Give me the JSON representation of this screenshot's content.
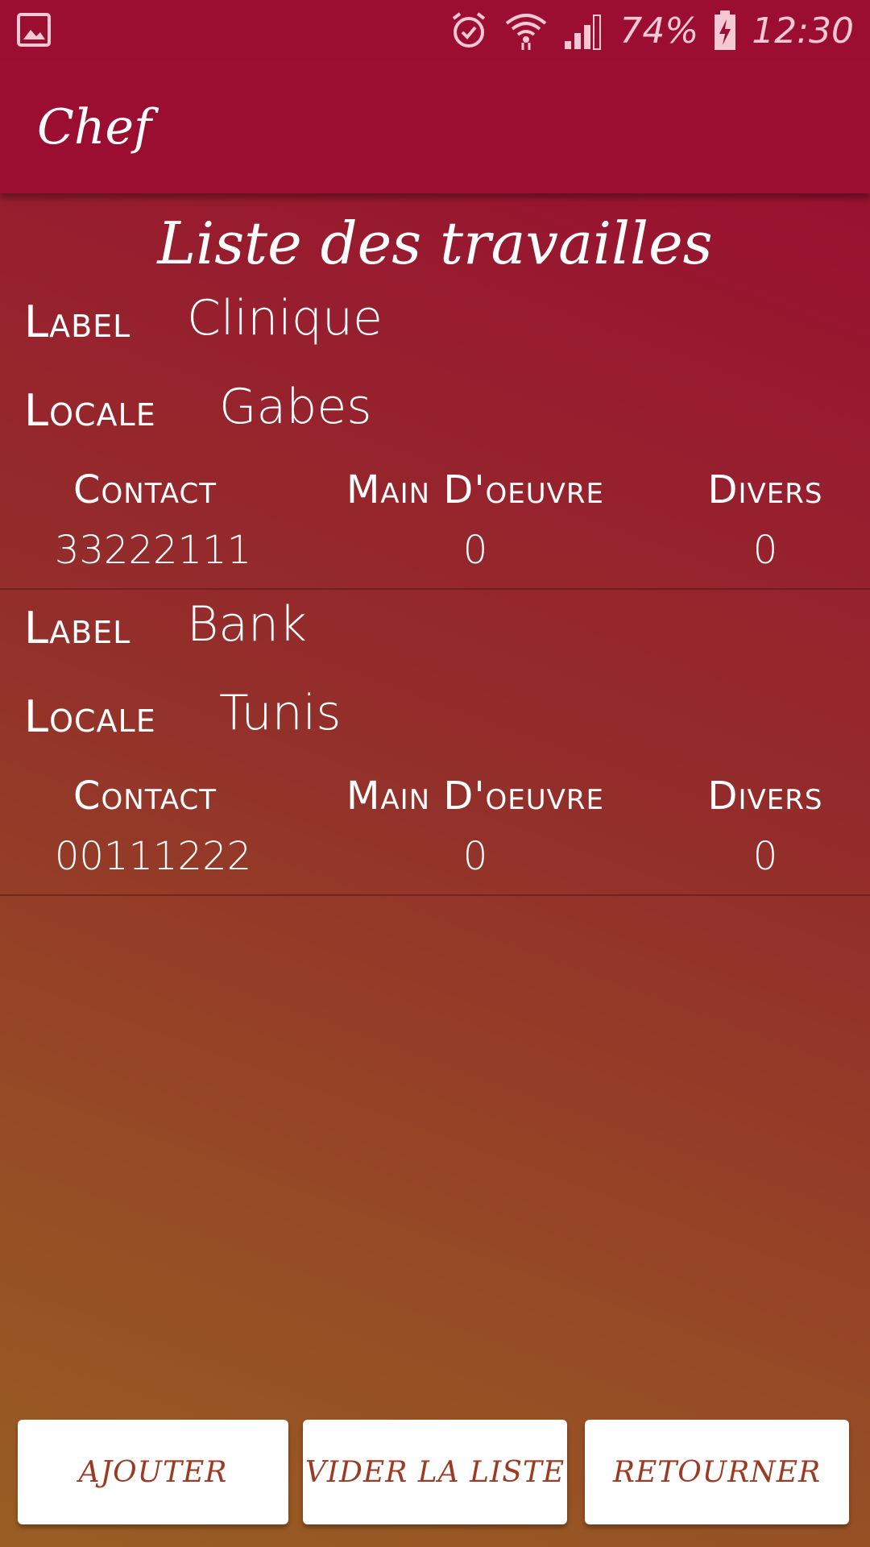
{
  "status_bar": {
    "battery": "74%",
    "time": "12:30",
    "icons": [
      "image-notification-icon",
      "alarm-icon",
      "wifi-icon",
      "signal-icon",
      "battery-charging-icon"
    ]
  },
  "app_bar": {
    "title": "Chef"
  },
  "page": {
    "heading": "Liste des travailles"
  },
  "jobs": [
    {
      "label_caption": "Label",
      "label_value": "Clinique",
      "locale_caption": "Locale",
      "locale_value": "Gabes",
      "contact_caption": "Contact",
      "contact_value": "33222111",
      "main_caption": "Main D'oeuvre",
      "main_value": "0",
      "divers_caption": "Divers",
      "divers_value": "0"
    },
    {
      "label_caption": "Label",
      "label_value": "Bank",
      "locale_caption": "Locale",
      "locale_value": "Tunis",
      "contact_caption": "Contact",
      "contact_value": "00111222",
      "main_caption": "Main D'oeuvre",
      "main_value": "0",
      "divers_caption": "Divers",
      "divers_value": "0"
    }
  ],
  "buttons": {
    "add": "AJOUTER",
    "clear": "VIDER LA LISTE",
    "back": "RETOURNER"
  },
  "colors": {
    "app_bar": "#9b0e31",
    "button_text": "#9c3a22",
    "gradient_top": "#9a1131",
    "gradient_bottom": "#995e23"
  }
}
